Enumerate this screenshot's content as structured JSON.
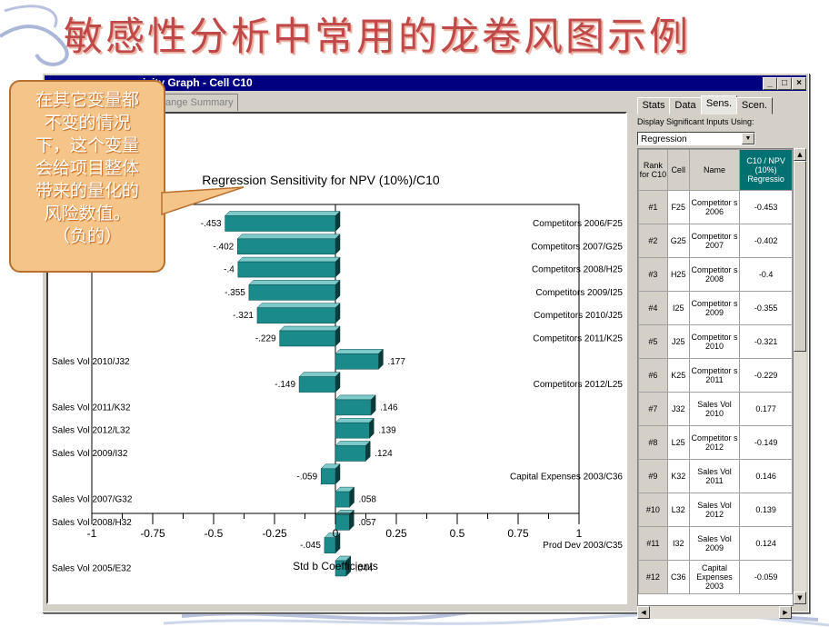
{
  "slide": {
    "title": "敏感性分析中常用的龙卷风图示例",
    "callout_lines": [
      "在其它变量都",
      "不变的情况",
      "下，这个变量",
      "会给项目整体",
      "带来的量化的",
      "风险数值。",
      "（负的）"
    ]
  },
  "window": {
    "title": "ivity Graph - Cell C10",
    "tab_partial": "ange Summary",
    "controls": [
      "minimize",
      "maximize",
      "close"
    ]
  },
  "right_panel": {
    "tabs": [
      "Stats",
      "Data",
      "Sens.",
      "Scen."
    ],
    "active_tab": "Sens.",
    "display_label": "Display Significant Inputs Using:",
    "display_value": "Regression",
    "columns": [
      "Rank for C10",
      "Cell",
      "Name",
      "C10 / NPV (10%) Regressio"
    ],
    "rows": [
      {
        "rank": "#1",
        "cell": "F25",
        "name": "Competitor s 2006",
        "value": "-0.453"
      },
      {
        "rank": "#2",
        "cell": "G25",
        "name": "Competitor s 2007",
        "value": "-0.402"
      },
      {
        "rank": "#3",
        "cell": "H25",
        "name": "Competitor s 2008",
        "value": "-0.4"
      },
      {
        "rank": "#4",
        "cell": "I25",
        "name": "Competitor s 2009",
        "value": "-0.355"
      },
      {
        "rank": "#5",
        "cell": "J25",
        "name": "Competitor s 2010",
        "value": "-0.321"
      },
      {
        "rank": "#6",
        "cell": "K25",
        "name": "Competitor s 2011",
        "value": "-0.229"
      },
      {
        "rank": "#7",
        "cell": "J32",
        "name": "Sales Vol 2010",
        "value": "0.177"
      },
      {
        "rank": "#8",
        "cell": "L25",
        "name": "Competitor s 2012",
        "value": "-0.149"
      },
      {
        "rank": "#9",
        "cell": "K32",
        "name": "Sales Vol 2011",
        "value": "0.146"
      },
      {
        "rank": "#10",
        "cell": "L32",
        "name": "Sales Vol 2012",
        "value": "0.139"
      },
      {
        "rank": "#11",
        "cell": "I32",
        "name": "Sales Vol 2009",
        "value": "0.124"
      },
      {
        "rank": "#12",
        "cell": "C36",
        "name": "Capital Expenses 2003",
        "value": "-0.059"
      }
    ]
  },
  "chart_data": {
    "type": "bar",
    "orientation": "horizontal",
    "title": "Regression Sensitivity for NPV (10%)/C10",
    "xlabel": "Std b Coefficients",
    "xlim": [
      -1,
      1
    ],
    "xticks": [
      -1,
      -0.75,
      -0.5,
      -0.25,
      0,
      0.25,
      0.5,
      0.75,
      1
    ],
    "xtick_labels": [
      "-1",
      "-0.75",
      "-0.5",
      "-0.25",
      "0",
      "0.25",
      "0.5",
      "0.75",
      "1"
    ],
    "bar_color": "#1a8a8a",
    "categories": [
      "Competitors 2006/F25",
      "Competitors 2007/G25",
      "Competitors 2008/H25",
      "Competitors 2009/I25",
      "Competitors 2010/J25",
      "Competitors 2011/K25",
      "Sales Vol 2010/J32",
      "Competitors 2012/L25",
      "Sales Vol 2011/K32",
      "Sales Vol 2012/L32",
      "Sales Vol 2009/I32",
      "Capital Expenses 2003/C36",
      "Sales Vol 2007/G32",
      "Sales Vol 2008/H32",
      "Prod Dev 2003/C35",
      "Sales Vol 2005/E32"
    ],
    "values": [
      -0.453,
      -0.402,
      -0.4,
      -0.355,
      -0.321,
      -0.229,
      0.177,
      -0.149,
      0.146,
      0.139,
      0.124,
      -0.059,
      0.058,
      0.057,
      -0.045,
      0.044
    ],
    "value_labels": [
      "-.453",
      "-.402",
      "-.4",
      "-.355",
      "-.321",
      "-.229",
      ".177",
      "-.149",
      ".146",
      ".139",
      ".124",
      "-.059",
      ".058",
      ".057",
      "-.045",
      ".044"
    ]
  }
}
